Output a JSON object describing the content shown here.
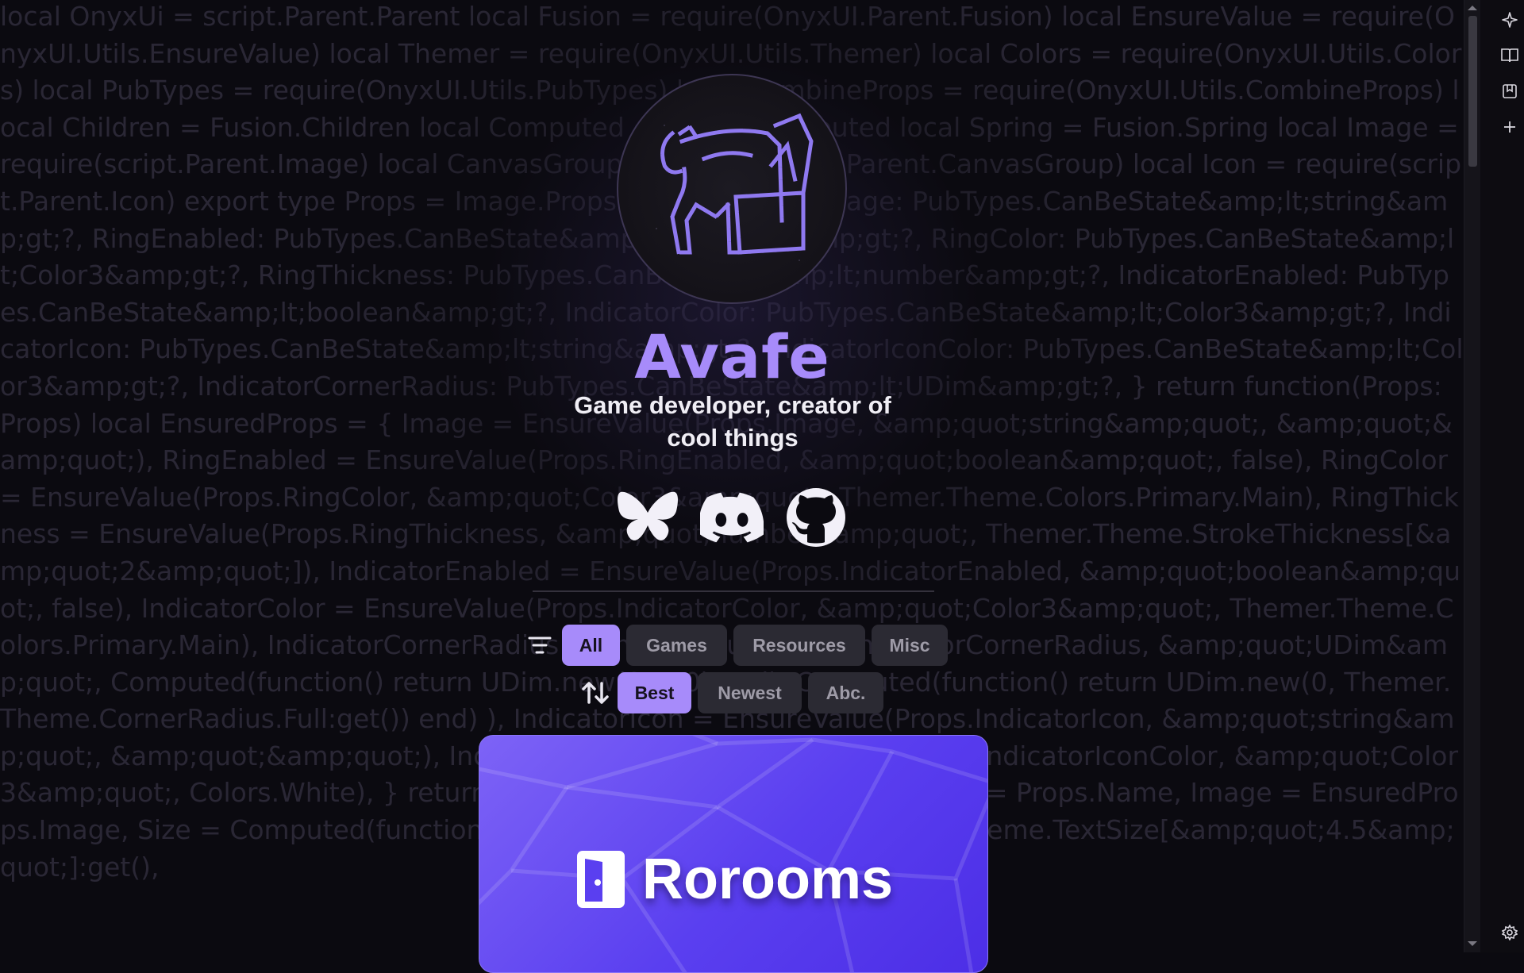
{
  "background_code": "local OnyxUi = script.Parent.Parent local Fusion = require(OnyxUI.Parent.Fusion) local EnsureValue = require(OnyxUI.Utils.EnsureValue) local Themer = require(OnyxUI.Utils.Themer) local Colors = require(OnyxUI.Utils.Colors) local PubTypes = require(OnyxUI.Utils.PubTypes) local CombineProps = require(OnyxUI.Utils.CombineProps) local Children = Fusion.Children local Computed = Fusion.Computed local Spring = Fusion.Spring local Image = require(script.Parent.Image) local CanvasGroup = require(script.Parent.CanvasGroup) local Icon = require(script.Parent.Icon) export type Props = Image.Props &amp;amp; { Image: PubTypes.CanBeState&amp;lt;string&amp;gt;?, RingEnabled: PubTypes.CanBeState&amp;lt;boolean&amp;gt;?, RingColor: PubTypes.CanBeState&amp;lt;Color3&amp;gt;?, RingThickness: PubTypes.CanBeState&amp;lt;number&amp;gt;?, IndicatorEnabled: PubTypes.CanBeState&amp;lt;boolean&amp;gt;?, IndicatorColor: PubTypes.CanBeState&amp;lt;Color3&amp;gt;?, IndicatorIcon: PubTypes.CanBeState&amp;lt;string&amp;gt;?, IndicatorIconColor: PubTypes.CanBeState&amp;lt;Color3&amp;gt;?, IndicatorCornerRadius: PubTypes.CanBeState&amp;lt;UDim&amp;gt;?, } return function(Props: Props) local EnsuredProps = { Image = EnsureValue(Props.Image, &amp;quot;string&amp;quot;, &amp;quot;&amp;quot;), RingEnabled = EnsureValue(Props.RingEnabled, &amp;quot;boolean&amp;quot;, false), RingColor = EnsureValue(Props.RingColor, &amp;quot;Color3&amp;quot;, Themer.Theme.Colors.Primary.Main), RingThickness = EnsureValue(Props.RingThickness, &amp;quot;number&amp;quot;, Themer.Theme.StrokeThickness[&amp;quot;2&amp;quot;]), IndicatorEnabled = EnsureValue(Props.IndicatorEnabled, &amp;quot;boolean&amp;quot;, false), IndicatorColor = EnsureValue(Props.IndicatorColor, &amp;quot;Color3&amp;quot;, Themer.Theme.Colors.Primary.Main), IndicatorCornerRadius = EnsureValue(Props.IndicatorCornerRadius, &amp;quot;UDim&amp;quot;, Computed(function() return UDim.new(0.5, 0) end), Computed(function() return UDim.new(0, Themer.Theme.CornerRadius.Full:get()) end) ), IndicatorIcon = EnsureValue(Props.IndicatorIcon, &amp;quot;string&amp;quot;, &amp;quot;&amp;quot;), IndicatorIconColor = EnsureValue(Props.IndicatorIconColor, &amp;quot;Color3&amp;quot;, Colors.White), } return Image(CombineProps(Props, { Name = Props.Name, Image = EnsuredProps.Image, Size = Computed(function() return UDim2.fromOffset(Themer.Theme.TextSize[&amp;quot;4.5&amp;quot;]:get(), ",
  "profile": {
    "name": "Avafe",
    "tagline": "Game developer, creator of cool things"
  },
  "socials": [
    {
      "name": "Bluesky",
      "icon": "butterfly-icon"
    },
    {
      "name": "Discord",
      "icon": "discord-icon"
    },
    {
      "name": "GitHub",
      "icon": "github-icon"
    }
  ],
  "filters": {
    "icon": "filter-icon",
    "items": [
      "All",
      "Games",
      "Resources",
      "Misc"
    ],
    "selected": "All"
  },
  "sort": {
    "icon": "sort-arrows-icon",
    "items": [
      "Best",
      "Newest",
      "Abc."
    ],
    "selected": "Best"
  },
  "project_card": {
    "title": "Rorooms",
    "icon": "door-icon"
  },
  "sidebar": {
    "buttons": [
      "sparkle-icon",
      "book-icon",
      "bookmark-icon",
      "plus-icon"
    ],
    "bottom": "settings-icon"
  },
  "colors": {
    "accent": "#a78bfa",
    "background": "#0b0a10",
    "card": "#5a3ff0"
  }
}
